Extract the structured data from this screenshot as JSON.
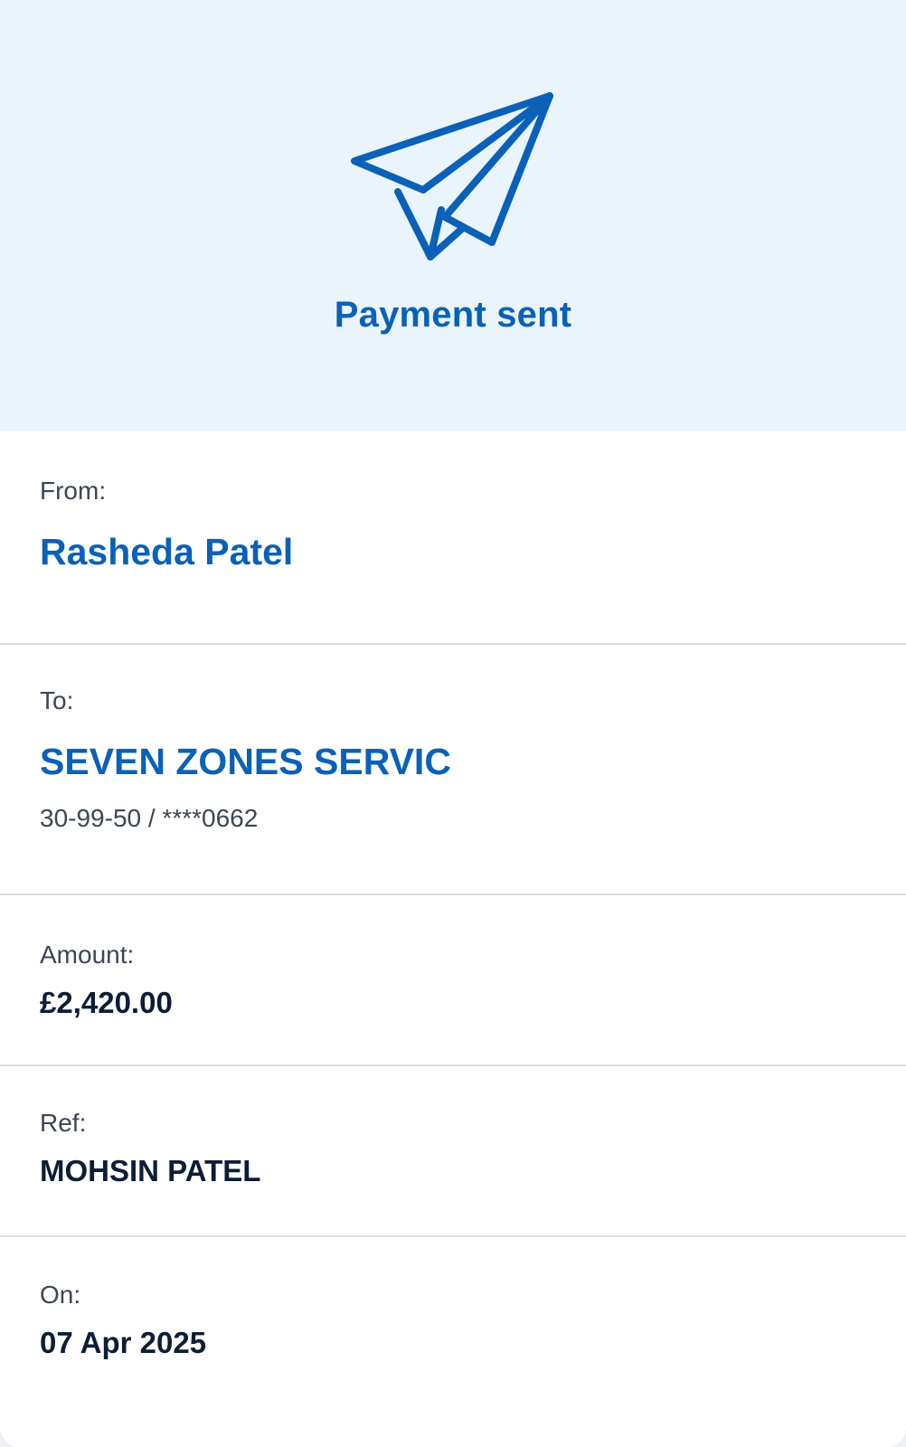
{
  "header": {
    "icon": "paper-plane-icon",
    "title": "Payment sent",
    "accent_color": "#0a61b7",
    "background_color": "#eaf4fd"
  },
  "from": {
    "label": "From:",
    "name": "Rasheda Patel"
  },
  "to": {
    "label": "To:",
    "name": "SEVEN ZONES SERVIC",
    "account": "30-99-50 / ****0662"
  },
  "amount": {
    "label": "Amount:",
    "value": "£2,420.00"
  },
  "ref": {
    "label": "Ref:",
    "value": "MOHSIN PATEL"
  },
  "date": {
    "label": "On:",
    "value": "07 Apr 2025"
  }
}
